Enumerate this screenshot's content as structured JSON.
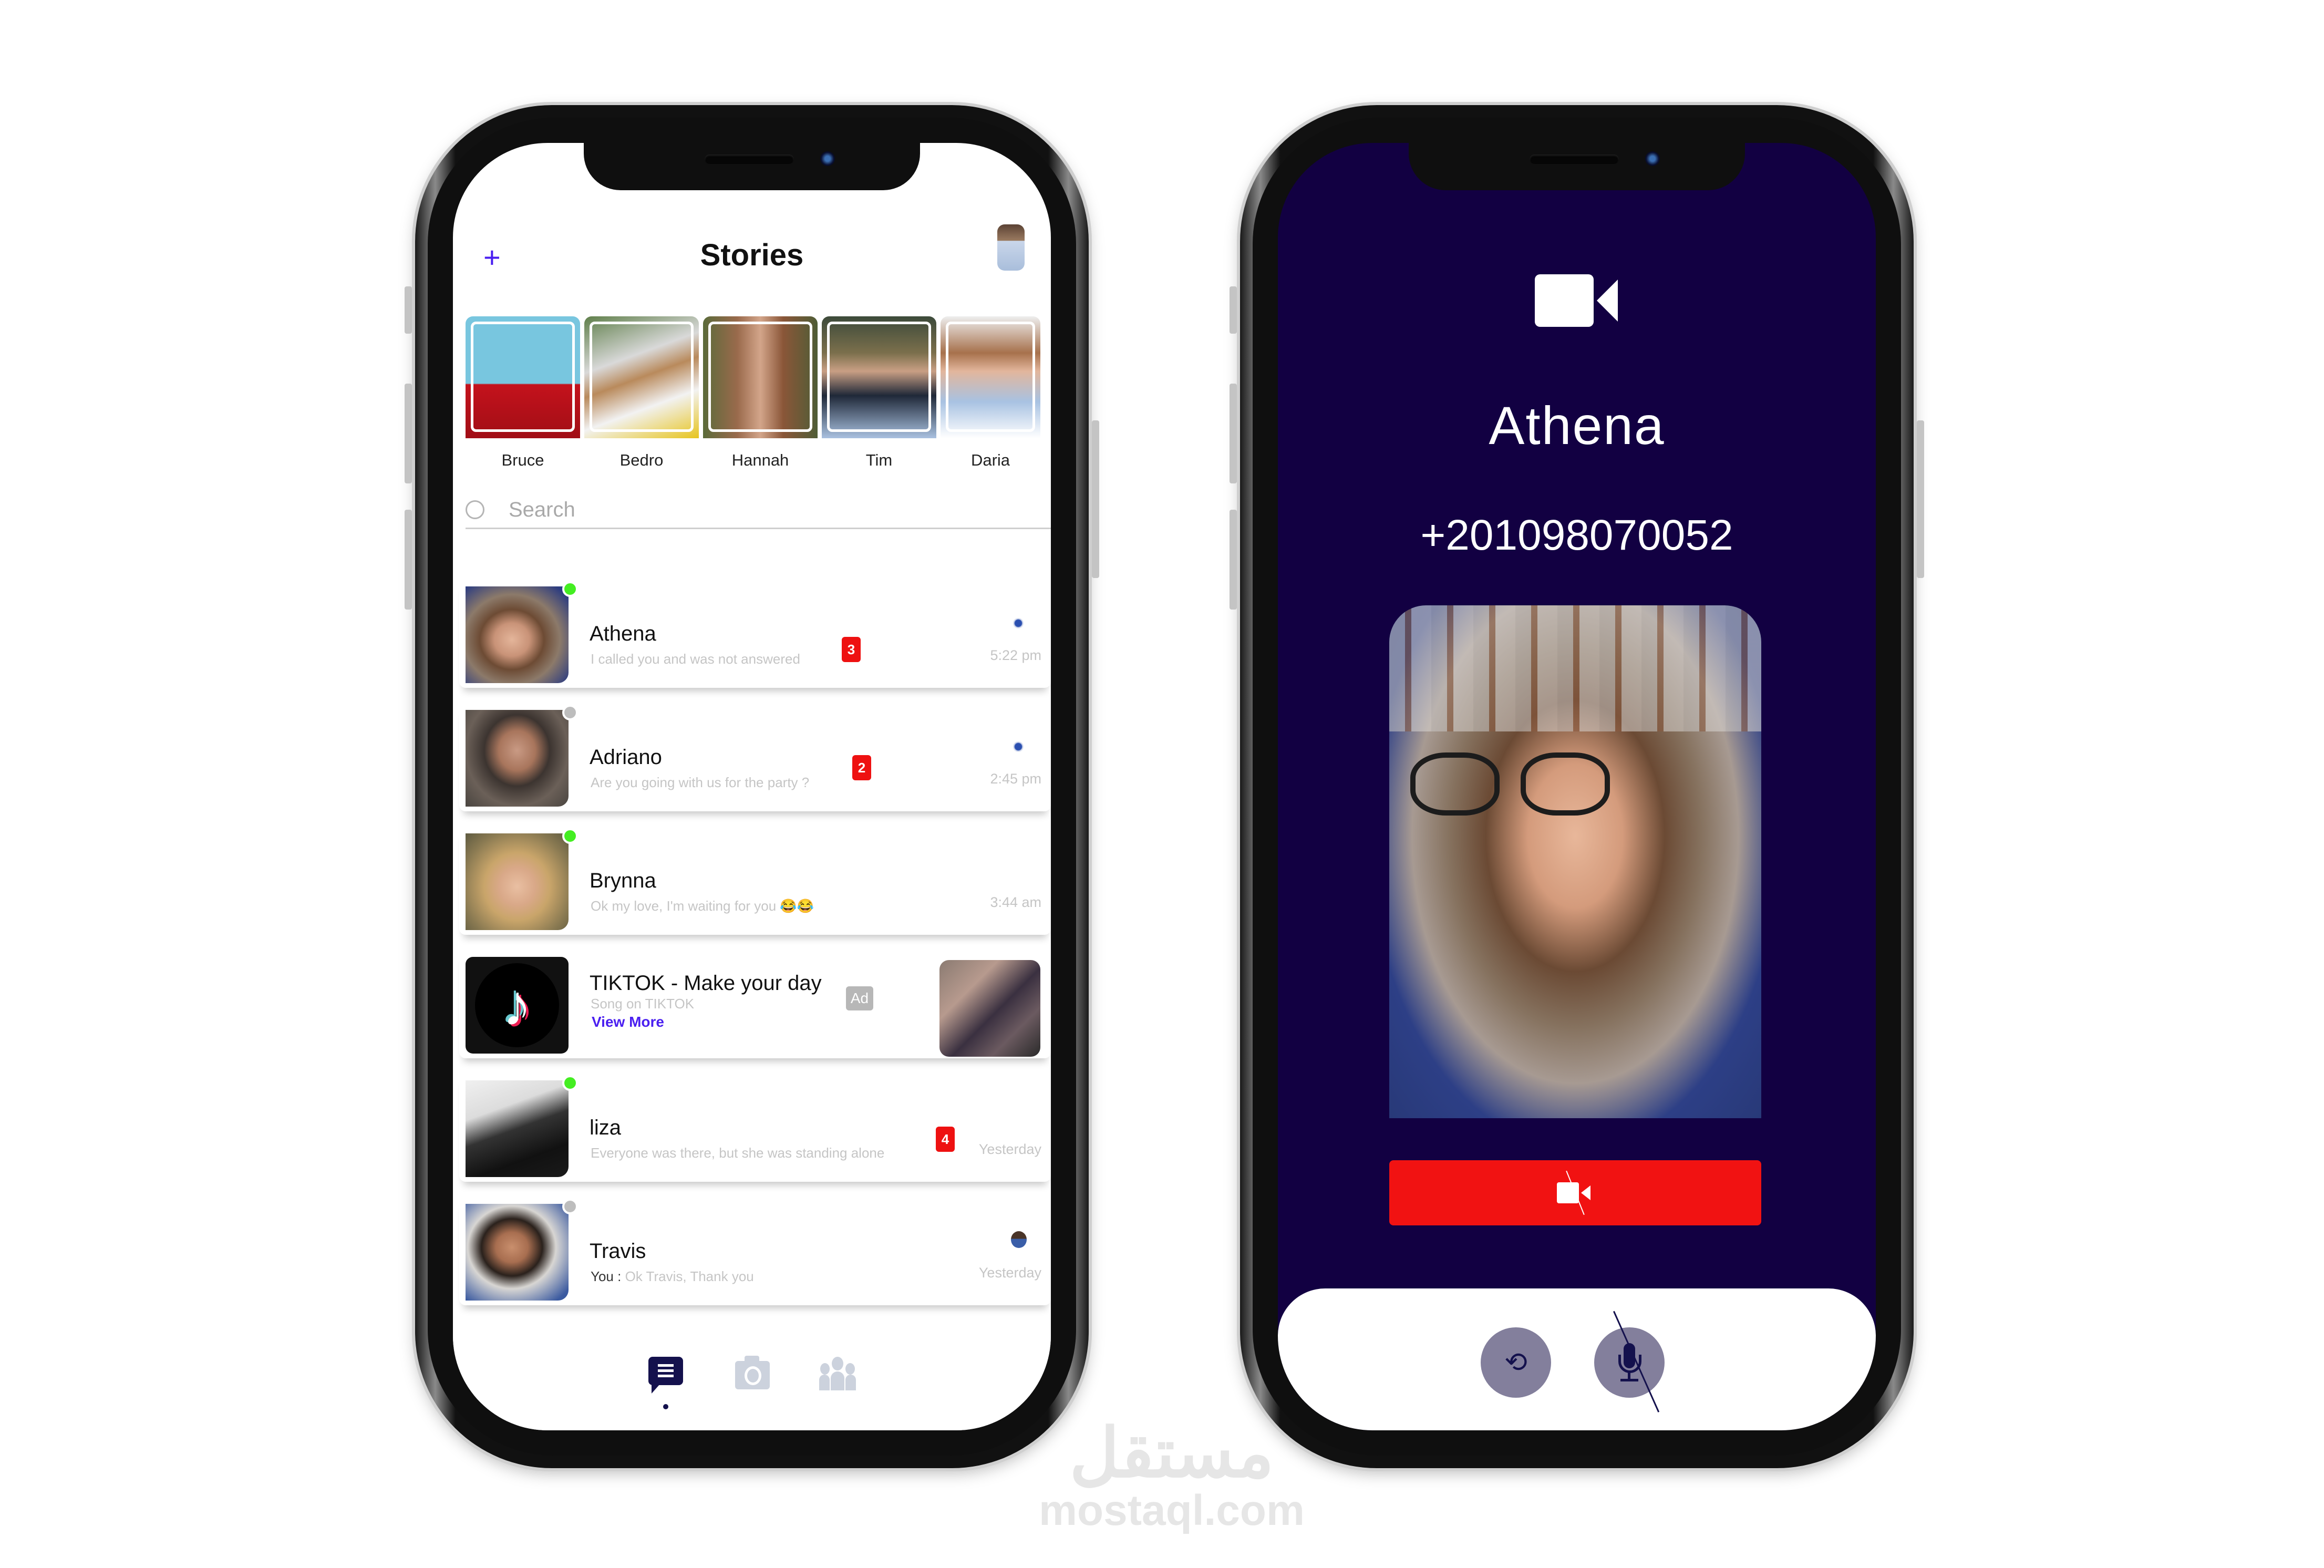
{
  "chat_screen": {
    "header": {
      "add_icon": "plus-icon",
      "title": "Stories"
    },
    "stories": [
      {
        "name": "Bruce"
      },
      {
        "name": "Bedro"
      },
      {
        "name": "Hannah"
      },
      {
        "name": "Tim"
      },
      {
        "name": "Daria"
      }
    ],
    "search": {
      "placeholder": "Search"
    },
    "chats": [
      {
        "name": "Athena",
        "message": "I called you and was not answered",
        "unread": "3",
        "time": "5:22 pm",
        "online": true
      },
      {
        "name": "Adriano",
        "message": "Are you going with us for the party ?",
        "unread": "2",
        "time": "2:45 pm",
        "online": false
      },
      {
        "name": "Brynna",
        "message": "Ok my love, I'm waiting for you 😂😂",
        "time": "3:44 am",
        "online": true
      },
      {
        "name": "TIKTOK - Make your day",
        "ad_tag": "Ad",
        "message": "Song on TIKTOK",
        "link": "View More"
      },
      {
        "name": "liza",
        "message": "Everyone was there, but she was standing alone",
        "unread": "4",
        "time": "Yesterday",
        "online": true
      },
      {
        "name": "Travis",
        "sender_prefix": "You :",
        "message": "Ok Travis, Thank you",
        "time": "Yesterday",
        "online": false
      }
    ],
    "tabs": [
      {
        "name": "chats",
        "icon": "chat-icon",
        "active": true
      },
      {
        "name": "camera",
        "icon": "camera-icon",
        "active": false
      },
      {
        "name": "groups",
        "icon": "group-icon",
        "active": false
      }
    ]
  },
  "call_screen": {
    "call_type_icon": "video-camera-icon",
    "callee_name": "Athena",
    "phone_number": "+201098070052",
    "end_call_icon": "video-off-icon",
    "controls": [
      {
        "name": "flip-camera",
        "icon": "camera-flip-icon"
      },
      {
        "name": "mute",
        "icon": "mic-off-icon"
      }
    ]
  },
  "colors": {
    "accent_purple": "#4a1ff0",
    "navy": "#14114d",
    "call_bg": "#120042",
    "badge_red": "#ee1111",
    "end_call_red": "#f11212",
    "online_green": "#44ee22",
    "offline_gray": "#bdbdbd"
  },
  "watermark": {
    "arabic": "مستقل",
    "latin": "mostaql.com"
  }
}
